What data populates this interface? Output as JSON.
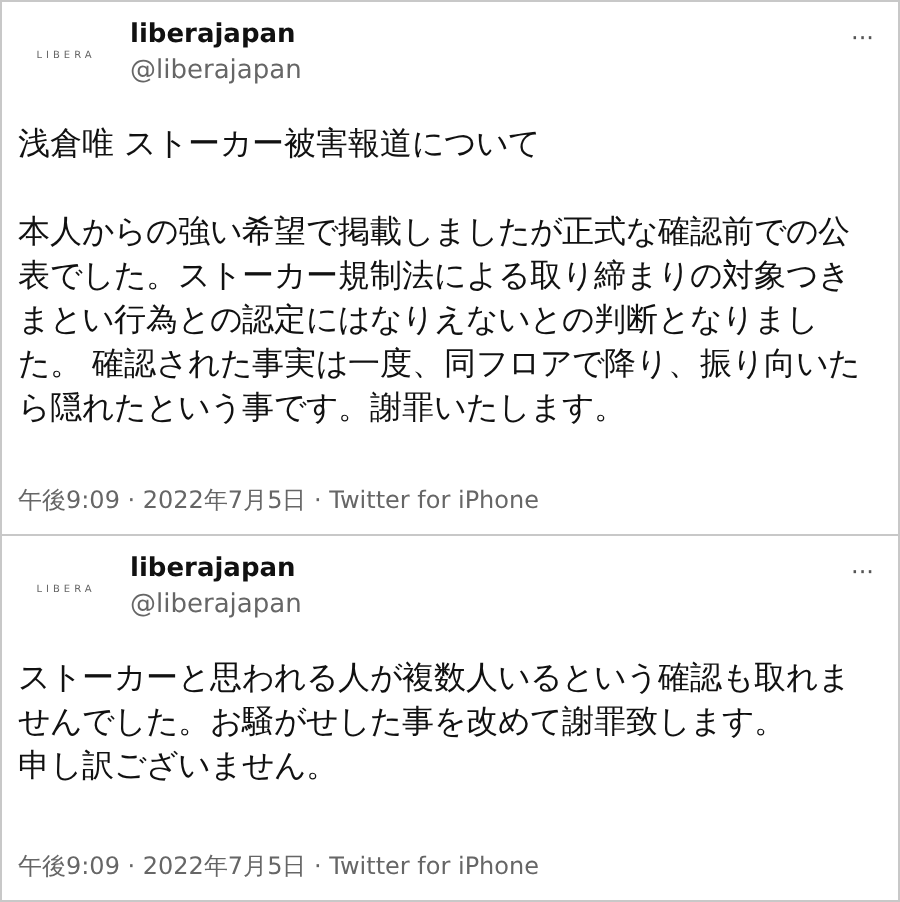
{
  "tweets": [
    {
      "avatar_text": "LIBERA",
      "name": "liberajapan",
      "handle": "@liberajapan",
      "more": "···",
      "paragraphs": [
        "浅倉唯 ストーカー被害報道について",
        "本人からの強い希望で掲載しましたが正式な確認前での公表でした。ストーカー規制法による取り締まりの対象つきまとい行為との認定にはなりえないとの判断となりました。 確認された事実は一度、同フロアで降り、振り向いたら隠れたという事です。謝罪いたします。"
      ],
      "meta": "午後9:09 · 2022年7月5日 · Twitter for iPhone"
    },
    {
      "avatar_text": "LIBERA",
      "name": "liberajapan",
      "handle": "@liberajapan",
      "more": "···",
      "paragraphs": [
        "ストーカーと思われる人が複数人いるという確認も取れませんでした。お騒がせした事を改めて謝罪致します。",
        "申し訳ございません。"
      ],
      "meta": "午後9:09 · 2022年7月5日 · Twitter for iPhone"
    }
  ]
}
